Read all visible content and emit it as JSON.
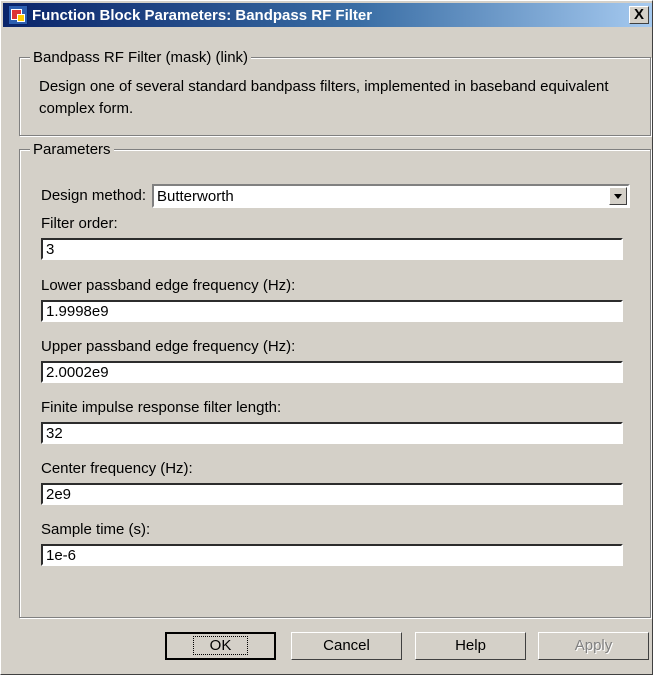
{
  "window": {
    "title": "Function Block Parameters: Bandpass RF Filter",
    "close_label": "X"
  },
  "description_group": {
    "legend": "Bandpass RF Filter (mask) (link)",
    "text": "Design one of several standard bandpass filters, implemented in baseband equivalent complex form."
  },
  "parameters_group": {
    "legend": "Parameters",
    "design_method": {
      "label": "Design method:",
      "value": "Butterworth"
    },
    "fields": [
      {
        "label": "Filter order:",
        "value": "3"
      },
      {
        "label": "Lower passband edge frequency (Hz):",
        "value": "1.9998e9"
      },
      {
        "label": "Upper passband edge frequency (Hz):",
        "value": "2.0002e9"
      },
      {
        "label": "Finite impulse response filter length:",
        "value": "32"
      },
      {
        "label": "Center frequency (Hz):",
        "value": "2e9"
      },
      {
        "label": "Sample time (s):",
        "value": "1e-6"
      }
    ]
  },
  "buttons": {
    "ok": "OK",
    "cancel": "Cancel",
    "help": "Help",
    "apply": "Apply"
  },
  "icons": {
    "app": "simulink-block-icon",
    "close": "close-icon",
    "dropdown": "chevron-down-icon"
  }
}
